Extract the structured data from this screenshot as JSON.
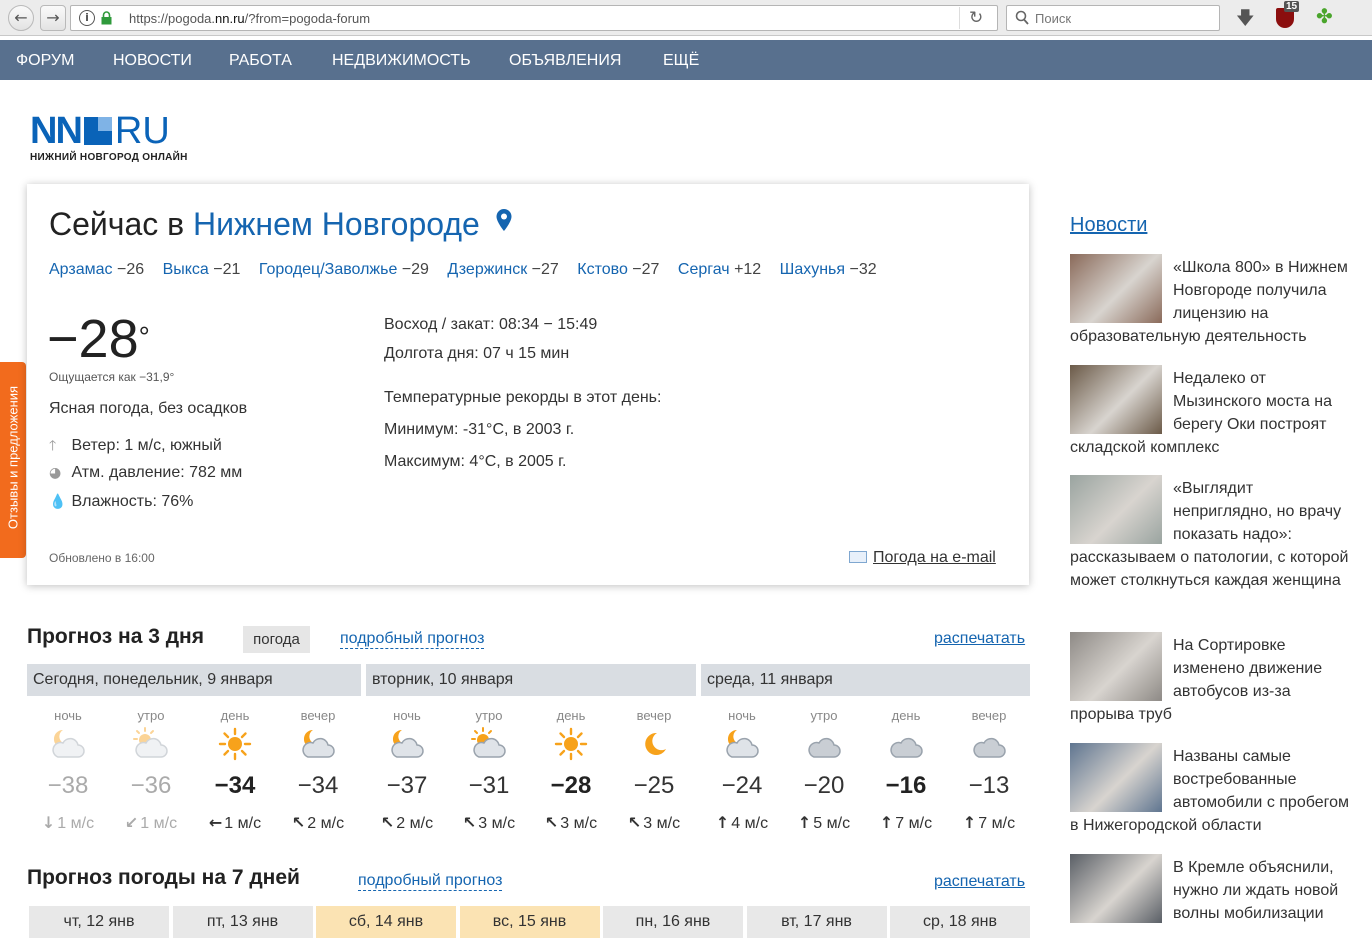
{
  "browser": {
    "url_prefix": "https://pogoda.",
    "url_domain": "nn.ru",
    "url_suffix": "/?from=pogoda-forum",
    "search_placeholder": "Поиск",
    "badge_count": "15"
  },
  "nav": {
    "items": [
      "ФОРУМ",
      "НОВОСТИ",
      "РАБОТА",
      "НЕДВИЖИМОСТЬ",
      "ОБЪЯВЛЕНИЯ",
      "ЕЩЁ"
    ]
  },
  "logo": {
    "nn": "NN",
    "ru": "RU",
    "subtitle": "НИЖНИЙ НОВГОРОД ОНЛАЙН"
  },
  "feedback": {
    "label": "Отзывы и предложения"
  },
  "current": {
    "title_prefix": "Сейчас в ",
    "city": "Нижнем Новгороде",
    "towns": [
      {
        "name": "Арзамас",
        "temp": "−26"
      },
      {
        "name": "Выкса",
        "temp": "−21"
      },
      {
        "name": "Городец/Заволжье",
        "temp": "−29"
      },
      {
        "name": "Дзержинск",
        "temp": "−27"
      },
      {
        "name": "Кстово",
        "temp": "−27"
      },
      {
        "name": "Сергач",
        "temp": "+12"
      },
      {
        "name": "Шахунья",
        "temp": "−32"
      }
    ],
    "temp": "−28",
    "deg": "°",
    "feels_like": "Ощущается как −31,9°",
    "condition": "Ясная погода, без осадков",
    "wind": "Ветер: 1 м/с, южный",
    "pressure": "Атм. давление: 782 мм",
    "humidity": "Влажность: 76%",
    "sunrise_sunset": "Восход / закат: 08:34 − 15:49",
    "day_length": "Долгота дня: 07 ч 15 мин",
    "records_title": "Температурные рекорды в этот день:",
    "record_min": "Минимум: -31°C, в 2003 г.",
    "record_max": "Максимум: 4°C, в 2005 г.",
    "updated": "Обновлено в 16:00",
    "email_link": "Погода на e-mail"
  },
  "forecast3": {
    "title": "Прогноз на 3 дня",
    "tag": "погода",
    "details_link": "подробный прогноз",
    "print_link": "распечатать",
    "days": [
      "Сегодня, понедельник, 9 января",
      "вторник, 10 января",
      "среда, 11 января"
    ],
    "periods": [
      {
        "tod": "ночь",
        "icon": "moon-cloud-icon",
        "temp": "−38",
        "wind": "1 м/с",
        "arrow": "↓",
        "style": "dim"
      },
      {
        "tod": "утро",
        "icon": "sun-cloud-icon",
        "temp": "−36",
        "wind": "1 м/с",
        "arrow": "↙",
        "style": "dim"
      },
      {
        "tod": "день",
        "icon": "sun-icon",
        "temp": "−34",
        "wind": "1 м/с",
        "arrow": "←",
        "style": "bold"
      },
      {
        "tod": "вечер",
        "icon": "moon-cloud-icon",
        "temp": "−34",
        "wind": "2 м/с",
        "arrow": "↖",
        "style": "normal"
      },
      {
        "tod": "ночь",
        "icon": "moon-cloud-icon",
        "temp": "−37",
        "wind": "2 м/с",
        "arrow": "↖",
        "style": "normal"
      },
      {
        "tod": "утро",
        "icon": "sun-cloud-icon",
        "temp": "−31",
        "wind": "3 м/с",
        "arrow": "↖",
        "style": "normal"
      },
      {
        "tod": "день",
        "icon": "sun-icon",
        "temp": "−28",
        "wind": "3 м/с",
        "arrow": "↖",
        "style": "bold"
      },
      {
        "tod": "вечер",
        "icon": "moon-icon",
        "temp": "−25",
        "wind": "3 м/с",
        "arrow": "↖",
        "style": "normal"
      },
      {
        "tod": "ночь",
        "icon": "moon-cloud-icon",
        "temp": "−24",
        "wind": "4 м/с",
        "arrow": "↑",
        "style": "normal"
      },
      {
        "tod": "утро",
        "icon": "cloud-icon",
        "temp": "−20",
        "wind": "5 м/с",
        "arrow": "↑",
        "style": "normal"
      },
      {
        "tod": "день",
        "icon": "cloud-icon",
        "temp": "−16",
        "wind": "7 м/с",
        "arrow": "↑",
        "style": "bold"
      },
      {
        "tod": "вечер",
        "icon": "cloud-icon",
        "temp": "−13",
        "wind": "7 м/с",
        "arrow": "↑",
        "style": "normal"
      }
    ]
  },
  "forecast7": {
    "title": "Прогноз погоды на 7 дней",
    "details_link": "подробный прогноз",
    "print_link": "распечатать",
    "days": [
      {
        "label": "чт, 12 янв",
        "weekend": false
      },
      {
        "label": "пт, 13 янв",
        "weekend": false
      },
      {
        "label": "сб, 14 янв",
        "weekend": true
      },
      {
        "label": "вс, 15 янв",
        "weekend": true
      },
      {
        "label": "пн, 16 янв",
        "weekend": false
      },
      {
        "label": "вт, 17 янв",
        "weekend": false
      },
      {
        "label": "ср, 18 янв",
        "weekend": false
      }
    ]
  },
  "news": {
    "title": "Новости",
    "items": [
      {
        "text": "«Школа 800» в Нижнем Новгороде получила лицензию на образовательную деятельность",
        "color": "#8a6a5a"
      },
      {
        "text": "Недалеко от Мызинского моста на берегу Оки построят складской комплекс",
        "color": "#6b5a48"
      },
      {
        "text": "«Выглядит неприглядно, но врачу показать надо»: рассказываем о патологии, с которой может столкнуться каждая женщина",
        "color": "#9aa4a0"
      },
      {
        "text": "На Сортировке изменено движение автобусов из-за прорыва труб",
        "color": "#8e8a86"
      },
      {
        "text": "Названы самые востребованные автомобили с пробегом в Нижегородской области",
        "color": "#5f7590"
      },
      {
        "text": "В Кремле объяснили, нужно ли ждать новой волны мобилизации",
        "color": "#5a5f66"
      }
    ]
  }
}
